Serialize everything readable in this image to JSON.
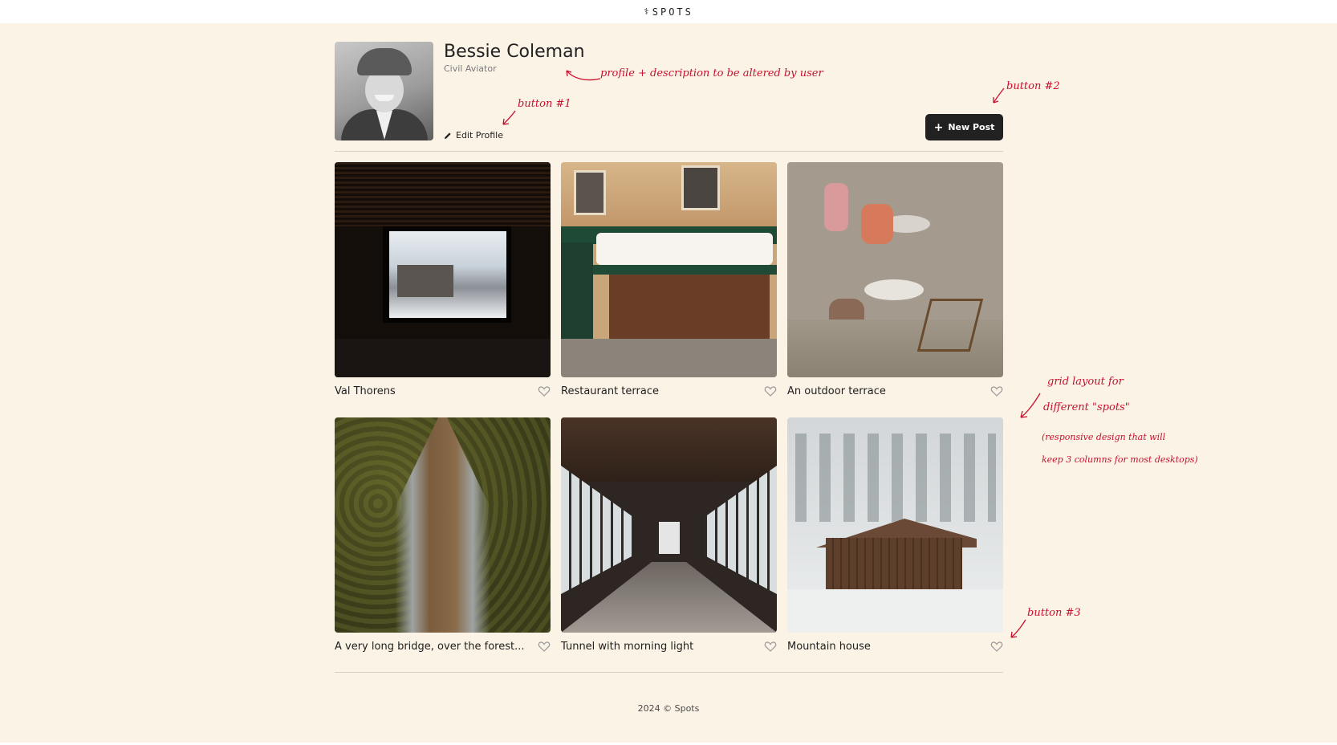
{
  "header": {
    "logo_mark": "⚕",
    "logo_text": "SPOTS"
  },
  "profile": {
    "name": "Bessie Coleman",
    "description": "Civil Aviator",
    "edit_label": "Edit Profile",
    "new_post_label": "New Post"
  },
  "cards": [
    {
      "caption": "Val Thorens",
      "image": "snowy-village-through-window"
    },
    {
      "caption": "Restaurant terrace",
      "image": "parisian-restaurant-storefront"
    },
    {
      "caption": "An outdoor terrace",
      "image": "cafe-terrace-tables"
    },
    {
      "caption": "A very long bridge, over the forest...",
      "image": "suspension-bridge-over-forest"
    },
    {
      "caption": "Tunnel with morning light",
      "image": "glass-walkway-tunnel"
    },
    {
      "caption": "Mountain house",
      "image": "wooden-cabin-in-snow"
    }
  ],
  "annotations": {
    "profile_note": "profile + description to be altered by user",
    "button1": "button #1",
    "button2": "button #2",
    "button3": "button #3",
    "grid_line1": "grid layout for",
    "grid_line2": "different \"spots\"",
    "grid_line3": "(responsive design that will",
    "grid_line4": "keep 3 columns for most desktops)"
  },
  "footer": {
    "text": "2024 © Spots"
  },
  "colors": {
    "background": "#fbf3e6",
    "button": "#212121",
    "annotation": "#c8102e",
    "text": "#212121"
  }
}
